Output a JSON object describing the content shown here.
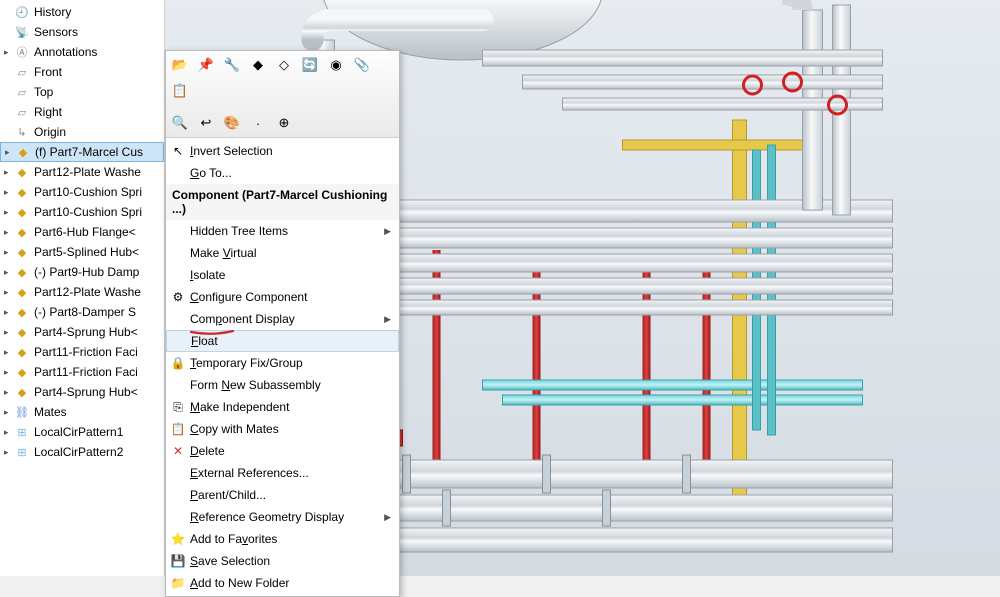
{
  "tree": {
    "items": [
      {
        "icon": "history",
        "label": "History",
        "expander": ""
      },
      {
        "icon": "sensor",
        "label": "Sensors",
        "expander": ""
      },
      {
        "icon": "annot",
        "label": "Annotations",
        "expander": "▸"
      },
      {
        "icon": "plane",
        "label": "Front",
        "expander": ""
      },
      {
        "icon": "plane",
        "label": "Top",
        "expander": ""
      },
      {
        "icon": "plane",
        "label": "Right",
        "expander": ""
      },
      {
        "icon": "origin",
        "label": "Origin",
        "expander": ""
      },
      {
        "icon": "part",
        "label": "(f) Part7-Marcel Cus",
        "expander": "▸",
        "selected": true
      },
      {
        "icon": "part",
        "label": "Part12-Plate Washe",
        "expander": "▸"
      },
      {
        "icon": "part",
        "label": "Part10-Cushion Spri",
        "expander": "▸"
      },
      {
        "icon": "part",
        "label": "Part10-Cushion Spri",
        "expander": "▸"
      },
      {
        "icon": "part",
        "label": "Part6-Hub Flange<",
        "expander": "▸"
      },
      {
        "icon": "part",
        "label": "Part5-Splined Hub<",
        "expander": "▸"
      },
      {
        "icon": "part",
        "label": "(-) Part9-Hub Damp",
        "expander": "▸"
      },
      {
        "icon": "part",
        "label": "Part12-Plate Washe",
        "expander": "▸"
      },
      {
        "icon": "part",
        "label": "(-) Part8-Damper S",
        "expander": "▸"
      },
      {
        "icon": "part",
        "label": "Part4-Sprung Hub<",
        "expander": "▸"
      },
      {
        "icon": "part",
        "label": "Part11-Friction Faci",
        "expander": "▸"
      },
      {
        "icon": "part",
        "label": "Part11-Friction Faci",
        "expander": "▸"
      },
      {
        "icon": "part",
        "label": "Part4-Sprung Hub<",
        "expander": "▸"
      },
      {
        "icon": "mates",
        "label": "Mates",
        "expander": "▸"
      },
      {
        "icon": "pattern",
        "label": "LocalCirPattern1",
        "expander": "▸"
      },
      {
        "icon": "pattern",
        "label": "LocalCirPattern2",
        "expander": "▸"
      }
    ]
  },
  "context": {
    "header": "Component (Part7-Marcel Cushioning ...)",
    "toolbar_row1": [
      "📂",
      "📌",
      "🔧",
      "◆",
      "◇",
      "🔄",
      "◉",
      "📎",
      "📋"
    ],
    "toolbar_row2": [
      "🔍",
      "↩",
      "🎨",
      "·",
      "⊕"
    ],
    "items": [
      {
        "icon": "↖",
        "label": "Invert Selection",
        "u": "I"
      },
      {
        "icon": "",
        "label": "Go To...",
        "u": "G"
      },
      {
        "header": true
      },
      {
        "icon": "",
        "label": "Hidden Tree Items",
        "sub": true
      },
      {
        "icon": "",
        "label": "Make Virtual",
        "u": "V"
      },
      {
        "icon": "",
        "label": "Isolate",
        "u": "I"
      },
      {
        "icon": "⚙",
        "label": "Configure Component",
        "u": "C"
      },
      {
        "icon": "",
        "label": "Component Display",
        "sub": true,
        "u": "p"
      },
      {
        "icon": "",
        "label": "Float",
        "u": "F",
        "highlighted": true
      },
      {
        "icon": "🔒",
        "label": "Temporary Fix/Group",
        "u": "T"
      },
      {
        "icon": "",
        "label": "Form New Subassembly",
        "u": "N"
      },
      {
        "icon": "⎘",
        "label": "Make Independent",
        "u": "M"
      },
      {
        "icon": "📋",
        "label": "Copy with Mates",
        "u": "C"
      },
      {
        "icon": "✕",
        "label": "Delete",
        "u": "D",
        "iconColor": "#cc3333"
      },
      {
        "icon": "",
        "label": "External References...",
        "u": "E"
      },
      {
        "icon": "",
        "label": "Parent/Child...",
        "u": "P"
      },
      {
        "icon": "",
        "label": "Reference Geometry Display",
        "sub": true,
        "u": "R"
      },
      {
        "icon": "⭐",
        "label": "Add to Favorites",
        "u": "v"
      },
      {
        "icon": "💾",
        "label": "Save Selection",
        "u": "S"
      },
      {
        "icon": "📁",
        "label": "Add to New Folder",
        "u": "A"
      }
    ]
  }
}
